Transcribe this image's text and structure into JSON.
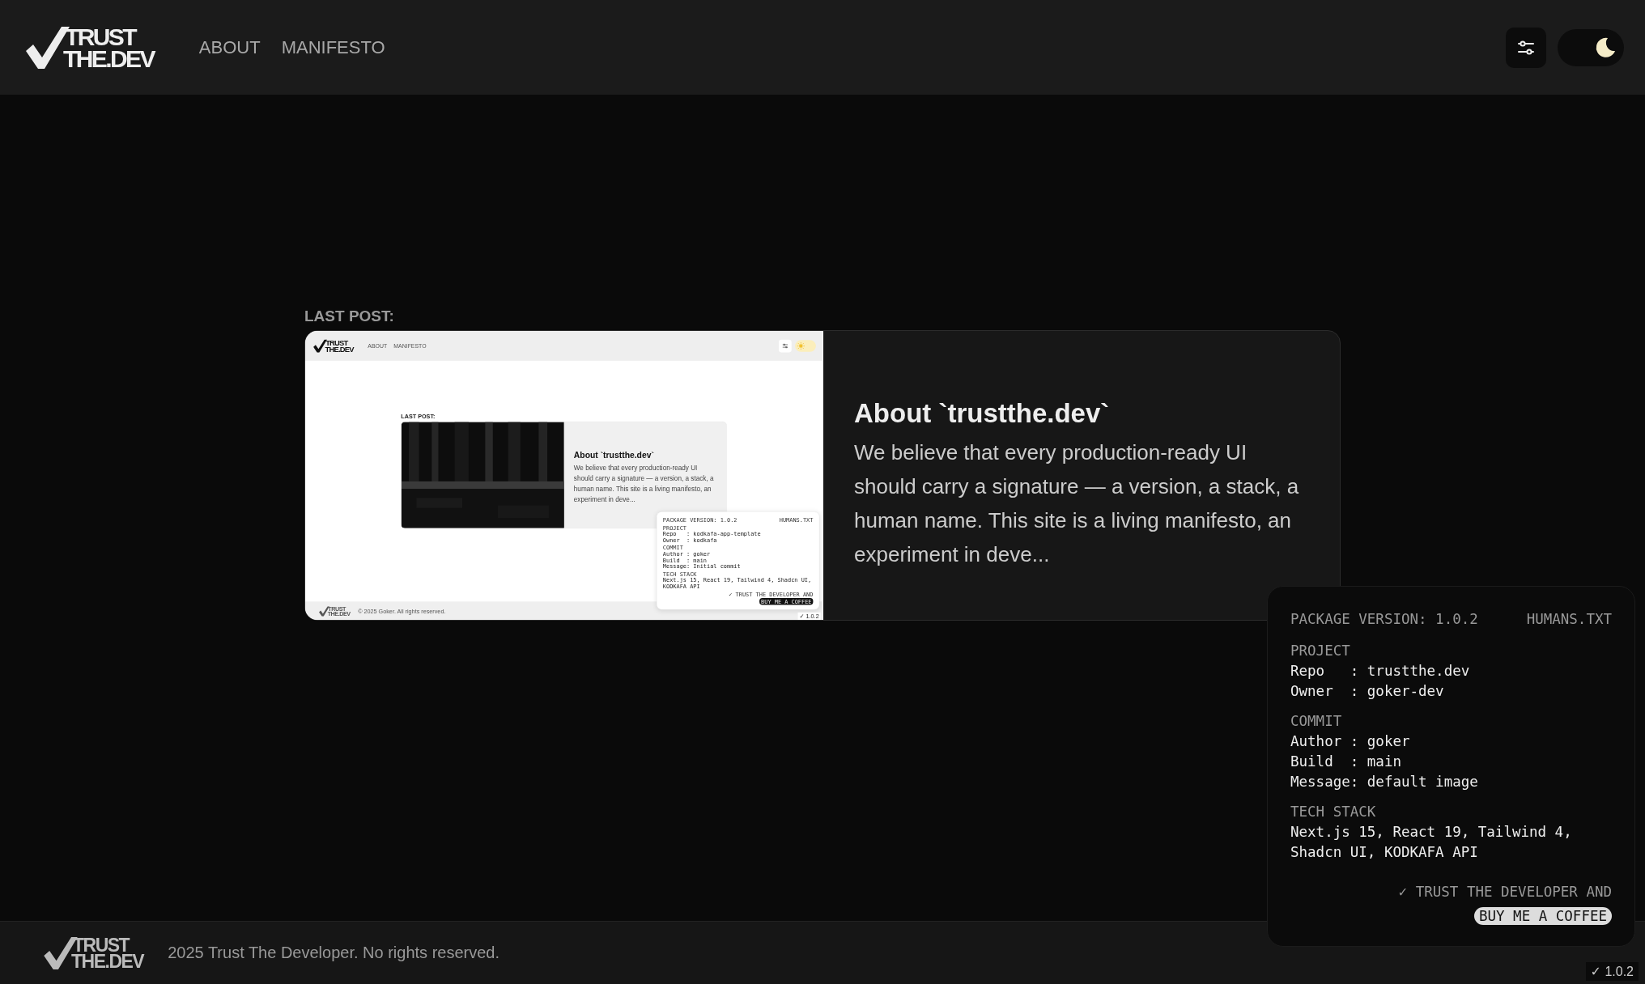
{
  "dark_theme": true,
  "header": {
    "logo": {
      "top": "TRUST",
      "bottom": "THE.DEV"
    },
    "nav": [
      {
        "label": "ABOUT"
      },
      {
        "label": "MANIFESTO"
      }
    ],
    "theme_toggle": {
      "dark_mode": true
    }
  },
  "last_post": {
    "label": "LAST POST:",
    "title": "About `trustthe.dev`",
    "excerpt": "We believe that every production-ready UI should carry a signature — a version, a stack, a human name. This site is a living manifesto, an experiment in deve...",
    "image": {
      "kind": "screenshot",
      "site": {
        "dark_theme": false,
        "header": {
          "logo": {
            "top": "TRUST",
            "bottom": "THE.DEV"
          },
          "nav": [
            {
              "label": "ABOUT"
            },
            {
              "label": "MANIFESTO"
            }
          ],
          "theme_toggle": {
            "dark_mode": false
          }
        },
        "last_post": {
          "label": "LAST POST:",
          "title": "About `trustthe.dev`",
          "excerpt": "We believe that every production-ready UI should carry a signature — a version, a stack, a human name. This site is a living manifesto, an experiment in deve..."
        },
        "footer": {
          "logo": {
            "top": "TRUST",
            "bottom": "THE.DEV"
          },
          "text": "© 2025 Goker. All rights reserved."
        },
        "humans_panel": {
          "version": "PACKAGE VERSION: 1.0.2",
          "link": "HUMANS.TXT",
          "sections": [
            {
              "heading": "PROJECT",
              "lines": [
                "Repo   : kodkafa-app-template",
                "Owner  : kodkafa"
              ]
            },
            {
              "heading": "COMMIT",
              "lines": [
                "Author : goker",
                "Build  : main",
                "Message: Initial commit"
              ]
            },
            {
              "heading": "TECH STACK",
              "lines": [
                "Next.js 15, React 19, Tailwind 4, Shadcn UI, KODKAFA API"
              ]
            }
          ],
          "note": "✓ TRUST THE DEVELOPER AND",
          "button": "BUY ME A COFFEE"
        },
        "version_badge": "✓ 1.0.2"
      }
    }
  },
  "footer": {
    "logo": {
      "top": "TRUST",
      "bottom": "THE.DEV"
    },
    "text": "2025 Trust The Developer. No rights reserved."
  },
  "humans_panel": {
    "version": "PACKAGE VERSION: 1.0.2",
    "link": "HUMANS.TXT",
    "sections": [
      {
        "heading": "PROJECT",
        "lines": [
          "Repo   : trustthe.dev",
          "Owner  : goker-dev"
        ]
      },
      {
        "heading": "COMMIT",
        "lines": [
          "Author : goker",
          "Build  : main",
          "Message: default image"
        ]
      },
      {
        "heading": "TECH STACK",
        "lines": [
          "Next.js 15, React 19, Tailwind 4, Shadcn UI, KODKAFA API"
        ]
      }
    ],
    "note": "✓ TRUST THE DEVELOPER AND",
    "button": "BUY ME A COFFEE"
  },
  "version_badge": "✓ 1.0.2"
}
